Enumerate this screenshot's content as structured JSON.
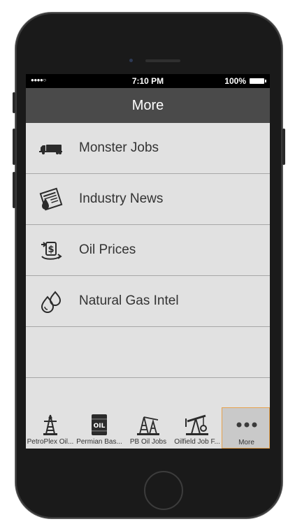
{
  "status_bar": {
    "signal": "●●●●○",
    "time": "7:10 PM",
    "battery": "100%"
  },
  "nav": {
    "title": "More"
  },
  "menu": {
    "items": [
      {
        "label": "Monster Jobs",
        "icon": "truck-icon"
      },
      {
        "label": "Industry News",
        "icon": "newspaper-oil-icon"
      },
      {
        "label": "Oil Prices",
        "icon": "money-exchange-icon"
      },
      {
        "label": "Natural Gas Intel",
        "icon": "drops-icon"
      }
    ]
  },
  "tabbar": {
    "tabs": [
      {
        "label": "PetroPlex Oil...",
        "icon": "oil-derrick-icon"
      },
      {
        "label": "Permian Bas...",
        "icon": "oil-barrel-icon"
      },
      {
        "label": "PB Oil Jobs",
        "icon": "oil-rig-icon"
      },
      {
        "label": "Oilfield Job F...",
        "icon": "pumpjack-icon"
      },
      {
        "label": "More",
        "icon": "more-dots-icon"
      }
    ],
    "active_tab": "More",
    "active_color": "#e6a24d"
  }
}
